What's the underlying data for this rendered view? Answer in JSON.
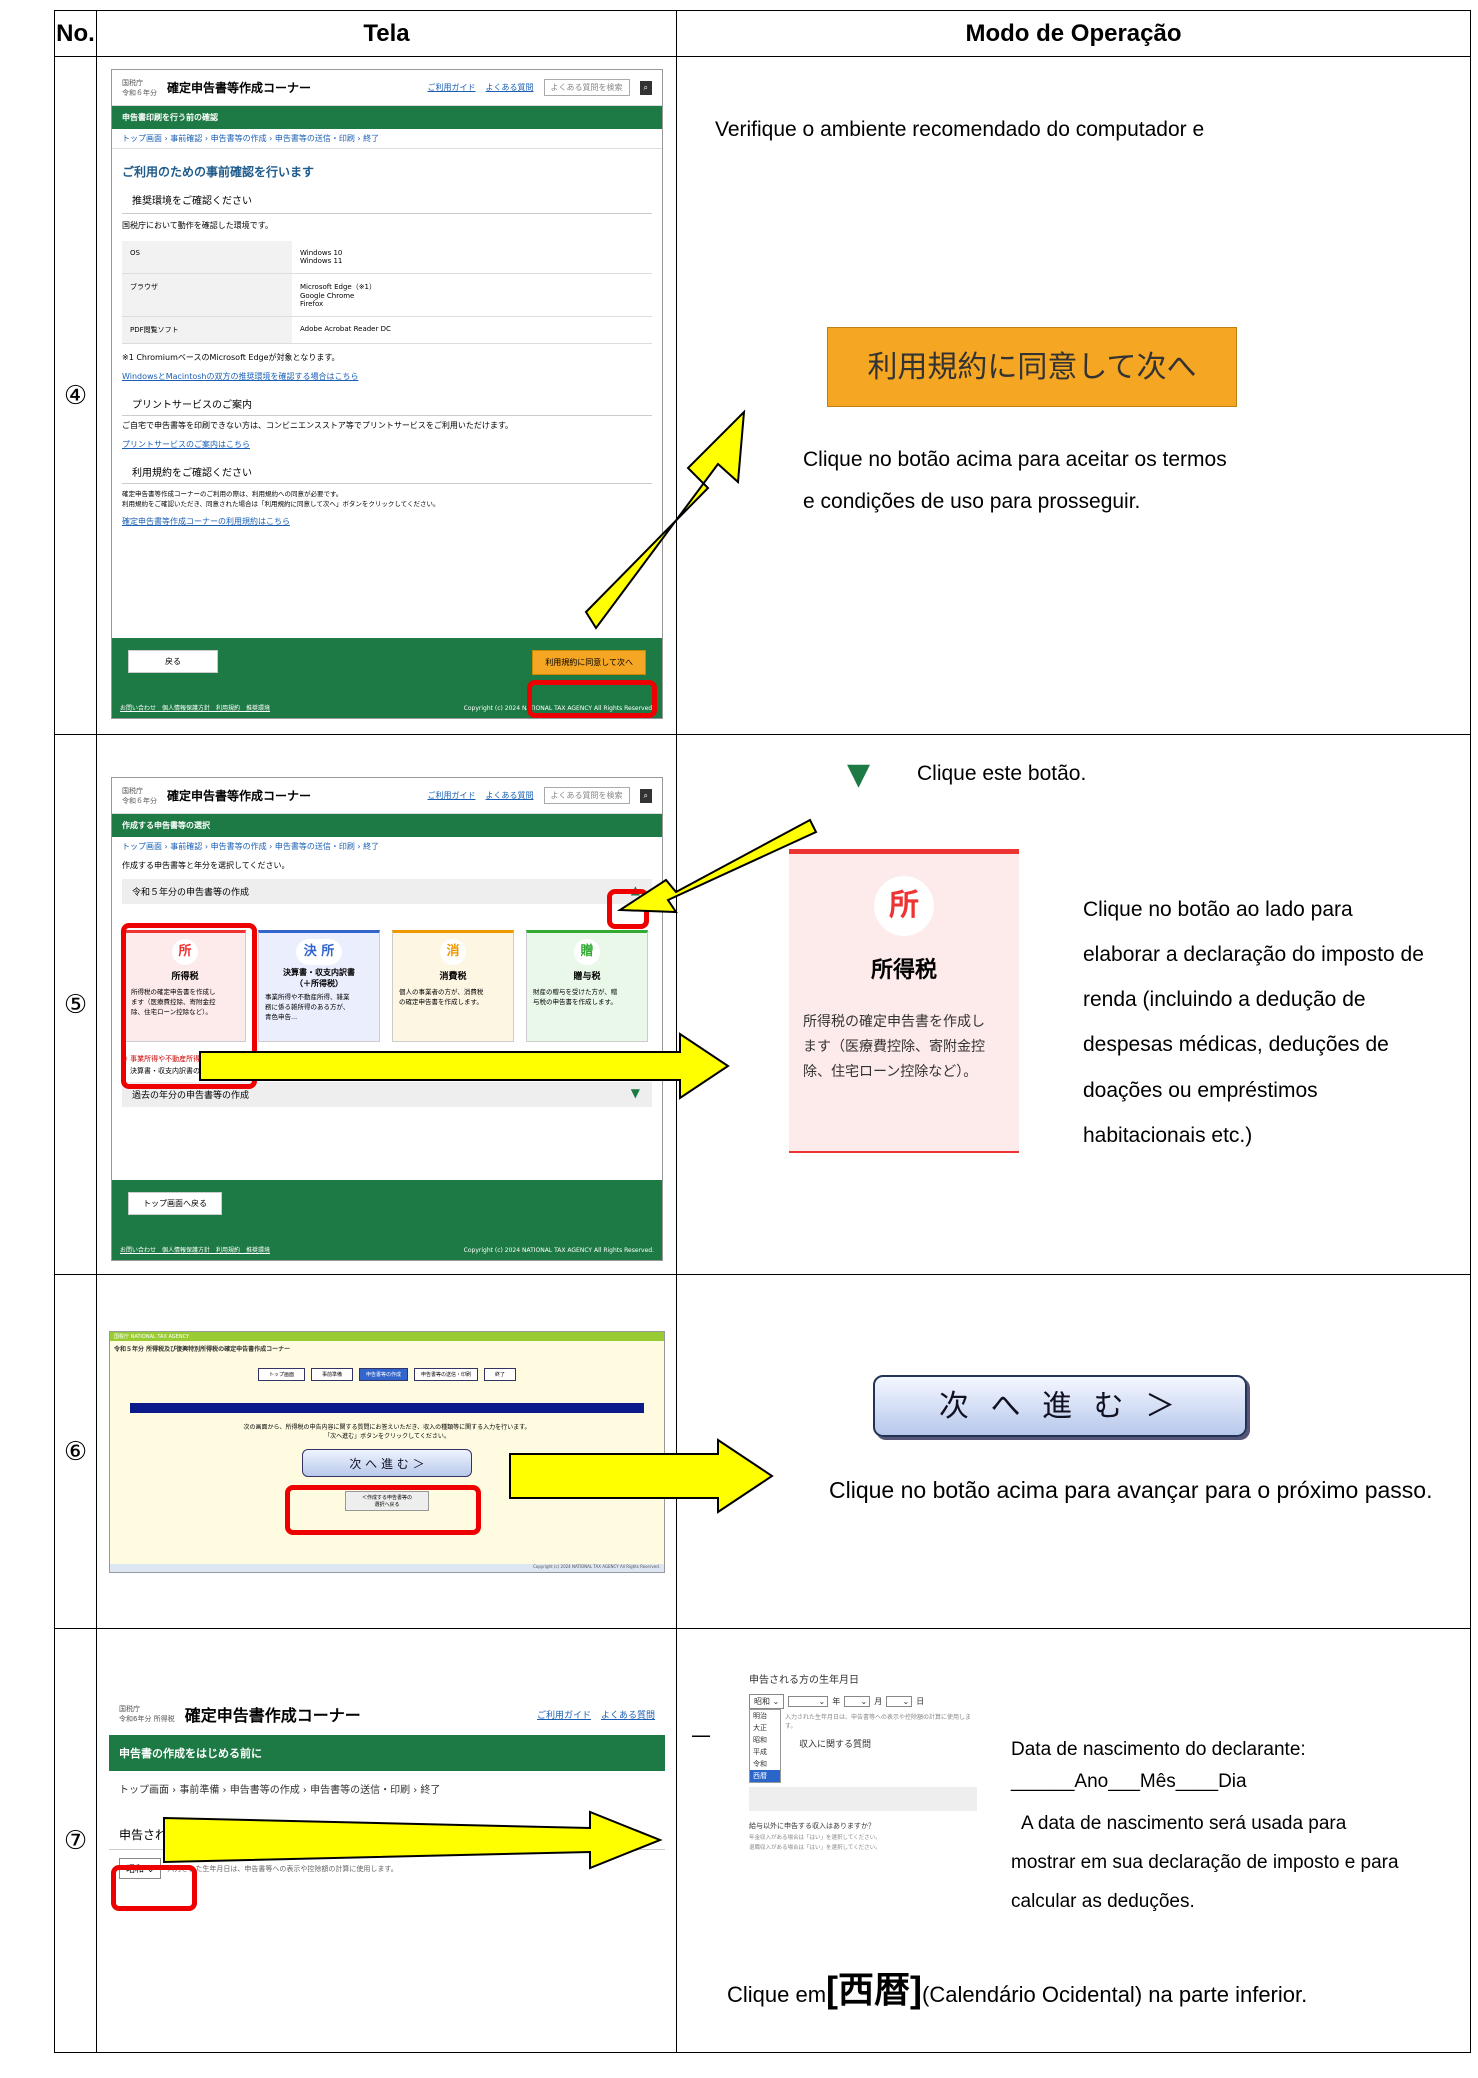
{
  "table": {
    "col_no": "No.",
    "col_screen": "Tela",
    "col_op": "Modo de Operação"
  },
  "rows": [
    {
      "num": "④",
      "op_intro": "Verifique o ambiente recomendado do computador e",
      "button": "利用規約に同意して次へ",
      "op_text": "Clique no botão acima para aceitar os termos\ne condições de uso para prosseguir.",
      "shot": {
        "agency": "国税庁\n令和６年分",
        "title": "確定申告書等作成コーナー",
        "guide": "ご利用ガイド",
        "faq": "よくある質問",
        "search": "よくある質問を検索",
        "bar": "申告書印刷を行う前の確認",
        "crumb": "トップ画面 › 事前確認 › 申告書等の作成 › 申告書等の送信・印刷 › 終了",
        "h": "ご利用のための事前確認を行います",
        "s1": "推奨環境をご確認ください",
        "s1d": "国税庁において動作を確認した環境です。",
        "env": [
          [
            "OS",
            "Windows 10\nWindows 11"
          ],
          [
            "ブラウザ",
            "Microsoft Edge（※1）\nGoogle Chrome\nFirefox"
          ],
          [
            "PDF閲覧ソフト",
            "Adobe Acrobat Reader DC"
          ]
        ],
        "note": "※1 ChromiumベースのMicrosoft Edgeが対象となります。",
        "link1": "WindowsとMacintoshの双方の推奨環境を確認する場合はこちら",
        "s2": "プリントサービスのご案内",
        "s2d": "ご自宅で申告書等を印刷できない方は、コンビニエンスストア等でプリントサービスをご利用いただけます。",
        "link2": "プリントサービスのご案内はこちら",
        "s3": "利用規約をご確認ください",
        "s3d": "確定申告書等作成コーナーのご利用の際は、利用規約への同意が必要です。\n利用規約をご確認いただき、同意された場合は「利用規約に同意して次へ」ボタンをクリックしてください。",
        "link3": "確定申告書等作成コーナーの利用規約はこちら",
        "back": "戻る",
        "next": "利用規約に同意して次へ",
        "foot_links": "お問い合わせ　個人情報保護方針　利用規約　推奨環境",
        "copyright": "Copyright (c) 2024 NATIONAL TAX AGENCY All Rights Reserved."
      }
    },
    {
      "num": "⑤",
      "click": "Clique este botão.",
      "op_text": "Clique no botão ao lado para\nelaborar a declaração do imposto de\nrenda (incluindo a dedução de\ndespesas médicas, deduções de\ndoações ou empréstimos\nhabitacionais etc.)",
      "zoom": {
        "kanji": "所",
        "title": "所得税",
        "desc": "所得税の確定申告書を作成し\nます（医療費控除、寄附金控\n除、住宅ローン控除など）。"
      },
      "shot": {
        "agency": "国税庁\n令和６年分",
        "title": "確定申告書等作成コーナー",
        "guide": "ご利用ガイド",
        "faq": "よくある質問",
        "search": "よくある質問を検索",
        "bar": "作成する申告書等の選択",
        "crumb": "トップ画面 › 事前確認 › 申告書等の作成 › 申告書等の送信・印刷 › 終了",
        "lead": "作成する申告書等と年分を選択してください。",
        "sect": "令和５年分の申告書等の作成",
        "cards": [
          {
            "k": "所",
            "t": "所得税",
            "d": "所得税の確定申告書を作成し\nます（医療費控除、寄附金控\n除、住宅ローン控除など）。"
          },
          {
            "k": "決 所",
            "t": "決算書・収支内訳書\n（＋所得税）",
            "d": "事業所得や不動産所得、雑業\n務に係る雑所得のある方が、\n青色申告..."
          },
          {
            "k": "消",
            "t": "消費税",
            "d": "個人の事業者の方が、消費税\nの確定申告書を作成します。"
          },
          {
            "k": "贈",
            "t": "贈与税",
            "d": "財産の贈与を受けた方が、贈\n与税の申告書を作成します。"
          }
        ],
        "warn": "※ 事業所得や不動産所得がある方は、「決算書・収支内訳書（＋所得税）」を選択してください。",
        "warn2": "決算書・収支内訳書の作成後、引き続き所得税の申告書を作成することができます。",
        "past": "過去の年分の申告書等の作成",
        "back": "トップ画面へ戻る",
        "foot_links": "お問い合わせ　個人情報保護方針　利用規約　推奨環境",
        "copyright": "Copyright (c) 2024 NATIONAL TAX AGENCY All Rights Reserved."
      }
    },
    {
      "num": "⑥",
      "button": "次 へ 進 む ＞",
      "op_text": "Clique no botão acima para avançar para o próximo passo.",
      "shot": {
        "header": "令和５年分 所得税及び復興特別所得税の確定申告書作成コーナー",
        "agency": "国税庁 NATIONAL TAX AGENCY",
        "steps": [
          "トップ画面",
          "事前準備",
          "申告書等の作成",
          "申告書等の送信・印刷",
          "終了"
        ],
        "lead": "次の画面から、所得税の申告内容に関する質問にお答えいただき、収入の種類等に関する入力を行います。\n「次へ進む」ボタンをクリックしてください。",
        "next": "次 へ 進 む ＞",
        "back": "＜作成する申告書等の\n選択へ戻る",
        "copyright": "Copyright (c) 2024 NATIONAL TAX AGENCY All Rights Reserved."
      }
    },
    {
      "num": "⑦",
      "dob_title": "Data de nascimento do declarante:",
      "dob_fmt": "______Ano___Mês____Dia",
      "dob_desc": "A data de nascimento será usada para\nmostrar em sua declaração de imposto e para\ncalcular as deduções.",
      "final_pre": "Clique em",
      "final_kanji": "[西暦]",
      "final_post": "(Calendário Ocidental)  na parte inferior.",
      "dash": "—",
      "zoom": {
        "label": "申告される方の生年月日",
        "era": "昭和",
        "year": "年",
        "month": "月",
        "day": "日",
        "note": "入力された生年月日は、申告書等への表示や控除額の計算に使用します。",
        "options": [
          "明治",
          "大正",
          "昭和",
          "平成",
          "令和",
          "西暦"
        ],
        "q": "収入に関する質問",
        "q1": "給与以外に申告する収入はありますか？",
        "q2": "年金収入がある場合は「はい」を選択してください。",
        "q3": "退職収入がある場合は「はい」を選択してください。"
      },
      "shot": {
        "agency": "国税庁\n令和6年分 所得税",
        "title": "確定申告書作成コーナー",
        "guide": "ご利用ガイド",
        "faq": "よくある質問",
        "bar": "申告書の作成をはじめる前に",
        "crumb": "トップ画面 › 事前準備 › 申告書等の作成 › 申告書等の送信・印刷 › 終了",
        "label": "申告される方の生年月日",
        "era": "昭和",
        "note": "入力された生年月日は、申告書等への表示や控除額の計算に使用します。"
      }
    }
  ],
  "colors": {
    "green": "#1e7a45",
    "red": "#e00000",
    "yellow": "#ffff00",
    "orange": "#f5a623"
  }
}
